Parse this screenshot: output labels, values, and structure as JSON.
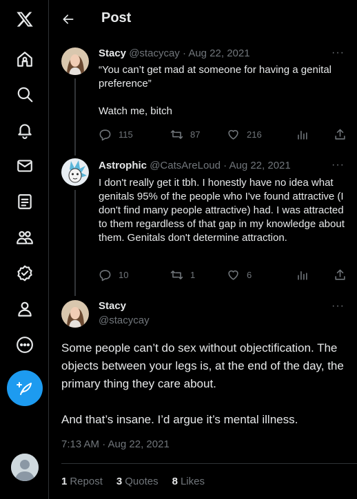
{
  "nav": {
    "items": [
      {
        "name": "x-logo-icon"
      },
      {
        "name": "home-icon"
      },
      {
        "name": "search-icon"
      },
      {
        "name": "notifications-icon"
      },
      {
        "name": "messages-icon"
      },
      {
        "name": "lists-icon"
      },
      {
        "name": "communities-icon"
      },
      {
        "name": "verified-icon"
      },
      {
        "name": "profile-icon"
      },
      {
        "name": "more-icon"
      }
    ],
    "post_button_icon": "feather-plus-icon",
    "accent_color": "#1d9bf0"
  },
  "header": {
    "title": "Post"
  },
  "tweets": [
    {
      "name": "Stacy",
      "handle": "@stacycay",
      "date": "Aug 22, 2021",
      "text": [
        "“You can’t get mad at someone for having a genital preference”",
        "Watch me, bitch"
      ],
      "replies": "115",
      "reposts": "87",
      "likes": "216"
    },
    {
      "name": "Astrophic",
      "handle": "@CatsAreLoud",
      "date": "Aug 22, 2021",
      "text": [
        "I don't really get it tbh. I honestly have no idea what genitals 95% of the people who I've found attractive (I don't find many people attractive) had. I was attracted to them regardless of that gap in my knowledge about them. Genitals don't determine attraction."
      ],
      "replies": "10",
      "reposts": "1",
      "likes": "6"
    }
  ],
  "main_tweet": {
    "name": "Stacy",
    "handle": "@stacycay",
    "text": [
      "Some people can’t do sex without objectification. The objects between your legs is, at the end of the day, the primary thing they care about.",
      "And that’s insane. I’d argue it’s mental illness."
    ],
    "timestamp": "7:13 AM · Aug 22, 2021",
    "reposts_count": "1",
    "reposts_label": "Repost",
    "quotes_count": "3",
    "quotes_label": "Quotes",
    "likes_count": "8",
    "likes_label": "Likes"
  },
  "separator": " · ",
  "more_glyph": "···"
}
